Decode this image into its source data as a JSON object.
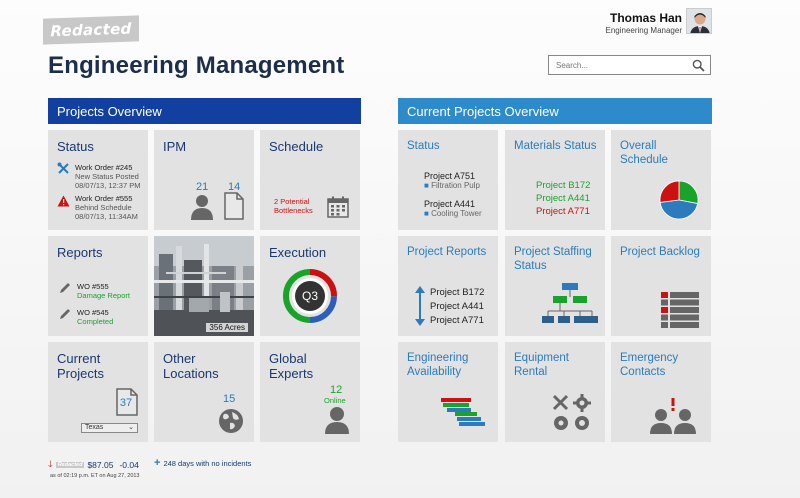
{
  "brand": {
    "logo_text": "Redacted"
  },
  "user": {
    "name": "Thomas Han",
    "role": "Engineering Manager"
  },
  "page_title": "Engineering Management",
  "search": {
    "placeholder": "Search..."
  },
  "sections": {
    "left": "Projects Overview",
    "right": "Current Projects Overview"
  },
  "tiles": {
    "status": {
      "title": "Status",
      "items": [
        {
          "title": "Work Order #245",
          "subtitle": "New Status Posted",
          "time": "08/07/13, 12:37 PM",
          "icon": "wrench-screwdriver-icon"
        },
        {
          "title": "Work Order #555",
          "subtitle": "Behind Schedule",
          "time": "08/07/13, 11:34AM",
          "icon": "warning-icon"
        }
      ]
    },
    "ipm": {
      "title": "IPM",
      "people_count": "21",
      "docs_count": "14"
    },
    "schedule": {
      "title": "Schedule",
      "alert_line1": "2 Potential",
      "alert_line2": "Bottlenecks"
    },
    "reports": {
      "title": "Reports",
      "items": [
        {
          "wo": "WO #555",
          "status": "Damage Report"
        },
        {
          "wo": "WO #545",
          "status": "Completed"
        }
      ]
    },
    "site_photo": {
      "caption": "356 Acres"
    },
    "execution": {
      "title": "Execution",
      "quarter": "Q3"
    },
    "current_projects": {
      "title_line1": "Current",
      "title_line2": "Projects",
      "count": "37",
      "dropdown_value": "Texas"
    },
    "other_locations": {
      "title_line1": "Other",
      "title_line2": "Locations",
      "count": "15"
    },
    "global_experts": {
      "title_line1": "Global",
      "title_line2": "Experts",
      "count": "12",
      "status": "Online"
    },
    "cp_status": {
      "title": "Status",
      "projects": [
        {
          "name": "Project A751",
          "detail": "Filtration Pulp"
        },
        {
          "name": "Project A441",
          "detail": "Cooling Tower"
        }
      ]
    },
    "materials_status": {
      "title": "Materials Status",
      "projects": [
        {
          "name": "Project B172",
          "color": "#1aa32b"
        },
        {
          "name": "Project A441",
          "color": "#1aa32b"
        },
        {
          "name": "Project A771",
          "color": "#cc1111"
        }
      ]
    },
    "overall_schedule": {
      "title_line1": "Overall",
      "title_line2": "Schedule",
      "pie_slices": [
        {
          "label": "green",
          "fraction": 0.28,
          "color": "#1aa32b"
        },
        {
          "label": "blue",
          "fraction": 0.45,
          "color": "#2b7bbd"
        },
        {
          "label": "red",
          "fraction": 0.27,
          "color": "#cc1111"
        }
      ]
    },
    "project_reports": {
      "title": "Project Reports",
      "projects": [
        "Project B172",
        "Project A441",
        "Project A771"
      ]
    },
    "project_staffing": {
      "title_line1": "Project Staffing",
      "title_line2": "Status"
    },
    "project_backlog": {
      "title": "Project Backlog"
    },
    "engineering_availability": {
      "title_line1": "Engineering",
      "title_line2": "Availability"
    },
    "equipment_rental": {
      "title_line1": "Equipment",
      "title_line2": "Rental"
    },
    "emergency_contacts": {
      "title_line1": "Emergency",
      "title_line2": "Contacts"
    }
  },
  "footer": {
    "ticker_label": "Redacted",
    "price": "$87.05",
    "change": "-0.04",
    "timestamp": "as of 02:19 p.m. ET on Aug 27, 2013",
    "safety": "248 days with no incidents"
  },
  "colors": {
    "primary_blue": "#1240a0",
    "light_blue": "#2e8bcb",
    "tile_bg": "#e2e2e2",
    "green": "#1aa32b",
    "red": "#cc1111"
  }
}
